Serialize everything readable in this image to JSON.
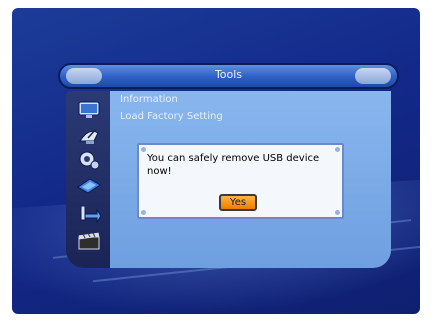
{
  "window": {
    "title": "Tools"
  },
  "menu": {
    "items": [
      {
        "label": "Information"
      },
      {
        "label": "Load Factory Setting"
      }
    ]
  },
  "dialog": {
    "message": "You can safely remove USB device now!",
    "yes_label": "Yes"
  },
  "sidebar": {
    "icons": [
      "monitor-icon",
      "satellite-dish-icon",
      "gear-icon",
      "tools-icon",
      "arrow-icon",
      "film-icon"
    ]
  },
  "colors": {
    "background": "#13298a",
    "content_panel": "#89b6ee",
    "yes_button": "#f07c00"
  }
}
